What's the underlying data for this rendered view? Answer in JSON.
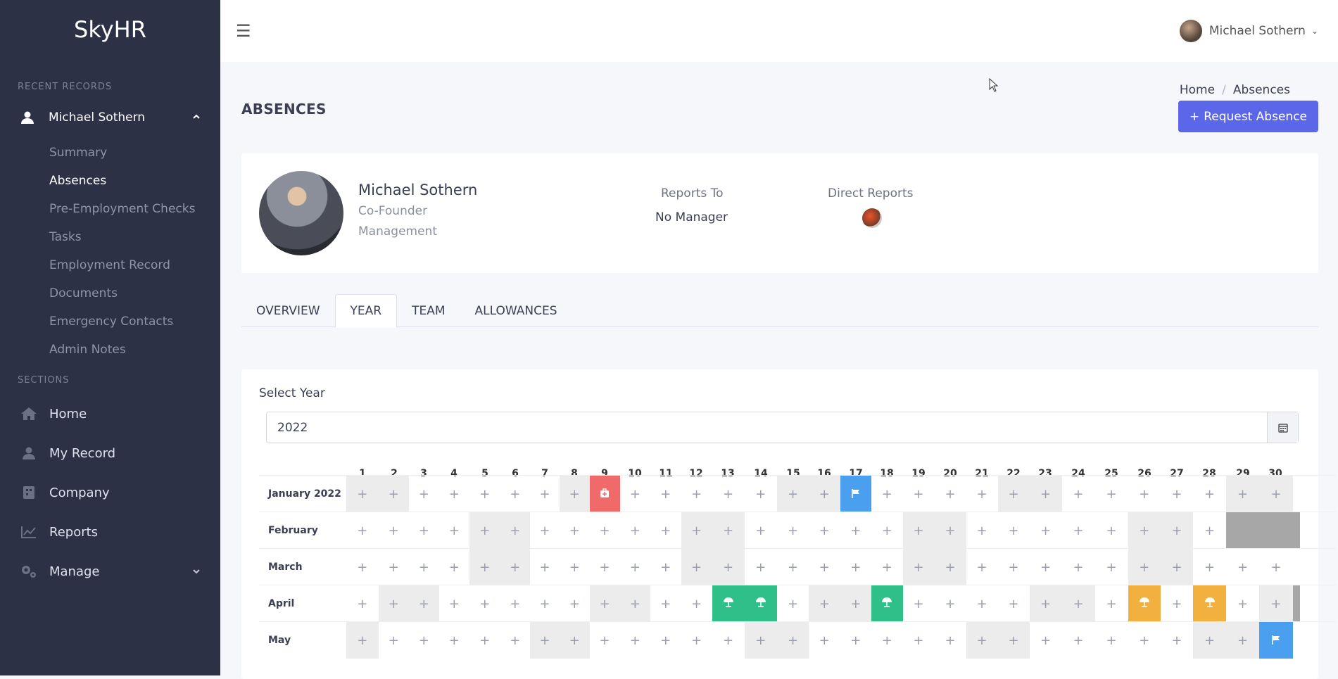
{
  "app": {
    "brand": "SkyHR"
  },
  "sidebar": {
    "recent_label": "RECENT RECORDS",
    "user_name": "Michael Sothern",
    "subitems": [
      {
        "label": "Summary",
        "active": false
      },
      {
        "label": "Absences",
        "active": true
      },
      {
        "label": "Pre-Employment Checks",
        "active": false
      },
      {
        "label": "Tasks",
        "active": false
      },
      {
        "label": "Employment Record",
        "active": false
      },
      {
        "label": "Documents",
        "active": false
      },
      {
        "label": "Emergency Contacts",
        "active": false
      },
      {
        "label": "Admin Notes",
        "active": false
      }
    ],
    "sections_label": "SECTIONS",
    "nav": [
      {
        "label": "Home",
        "icon": "home-icon"
      },
      {
        "label": "My Record",
        "icon": "user-icon"
      },
      {
        "label": "Company",
        "icon": "building-icon"
      },
      {
        "label": "Reports",
        "icon": "chart-icon"
      },
      {
        "label": "Manage",
        "icon": "gears-icon"
      }
    ]
  },
  "topbar": {
    "user_name": "Michael Sothern"
  },
  "page": {
    "title": "ABSENCES",
    "breadcrumb": [
      "Home",
      "Absences"
    ],
    "request_button": "Request Absence"
  },
  "profile": {
    "name": "Michael Sothern",
    "role": "Co-Founder",
    "department": "Management",
    "reports_to_label": "Reports To",
    "reports_to_value": "No Manager",
    "direct_reports_label": "Direct Reports"
  },
  "tabs": [
    {
      "label": "OVERVIEW",
      "active": false
    },
    {
      "label": "YEAR",
      "active": true
    },
    {
      "label": "TEAM",
      "active": false
    },
    {
      "label": "ALLOWANCES",
      "active": false
    }
  ],
  "year_panel": {
    "select_label": "Select Year",
    "year_value": "2022"
  },
  "calendar": {
    "days": [
      "1",
      "2",
      "3",
      "4",
      "5",
      "6",
      "7",
      "8",
      "9",
      "10",
      "11",
      "12",
      "13",
      "14",
      "15",
      "16",
      "17",
      "18",
      "19",
      "20",
      "21",
      "22",
      "23",
      "24",
      "25",
      "26",
      "27",
      "28",
      "29",
      "30"
    ],
    "colors": {
      "sick": "#f06a6a",
      "holiday": "#2fc08a",
      "flag": "#4aa0ef",
      "pending": "#f2b13e",
      "blocked": "#a7a7a7"
    },
    "months": [
      {
        "name": "January 2022",
        "weekends": [
          1,
          2,
          8,
          9,
          15,
          16,
          22,
          23,
          29,
          30
        ],
        "events": [
          {
            "day": 9,
            "type": "sick"
          },
          {
            "day": 17,
            "type": "flag"
          }
        ]
      },
      {
        "name": "February",
        "weekends": [
          5,
          6,
          12,
          13,
          19,
          20,
          26,
          27
        ],
        "events": [],
        "blocked_from": 29
      },
      {
        "name": "March",
        "weekends": [
          5,
          6,
          12,
          13,
          19,
          20,
          26,
          27
        ],
        "events": []
      },
      {
        "name": "April",
        "weekends": [
          2,
          3,
          9,
          10,
          16,
          17,
          23,
          24,
          30
        ],
        "events": [
          {
            "day": 13,
            "type": "holiday"
          },
          {
            "day": 14,
            "type": "holiday"
          },
          {
            "day": 18,
            "type": "holiday"
          },
          {
            "day": 26,
            "type": "pending"
          },
          {
            "day": 28,
            "type": "pending"
          }
        ]
      },
      {
        "name": "May",
        "weekends": [
          1,
          7,
          8,
          14,
          15,
          21,
          22,
          28,
          29
        ],
        "events": [
          {
            "day": 30,
            "type": "flag"
          }
        ]
      }
    ]
  }
}
